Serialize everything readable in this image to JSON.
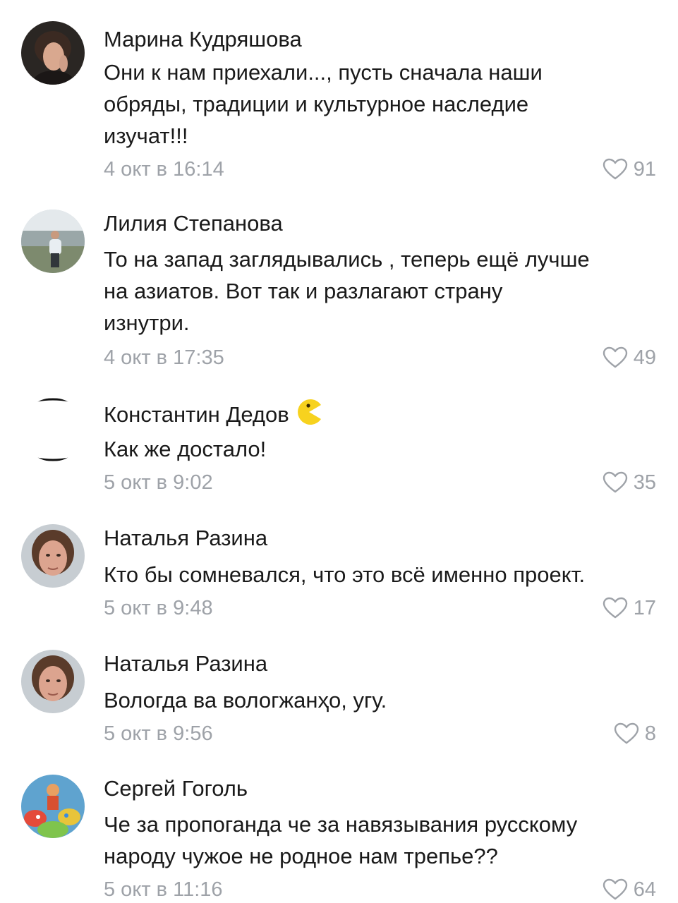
{
  "comments": [
    {
      "author": "Марина Кудряшова",
      "text_lines": [
        "Они к нам приехали..., пусть сначала наши",
        "обряды, традиции и культурное наследие",
        "изучат!!!"
      ],
      "date": "4 окт в 16:14",
      "likes": "91"
    },
    {
      "author": "Лилия Степанова",
      "text_lines": [
        "То на запад заглядывались , теперь ещё лучше",
        "на азиатов. Вот так и разлагают страну",
        "изнутри."
      ],
      "date": "4 окт в 17:35",
      "likes": "49"
    },
    {
      "author": "Константин Дедов",
      "text_lines": [
        "Как же достало!"
      ],
      "date": "5 окт в 9:02",
      "likes": "35",
      "badge_icon": "pacman-emoji-icon"
    },
    {
      "author": "Наталья Разина",
      "text_lines": [
        "Кто бы сомневался, что это всё именно проект."
      ],
      "date": "5 окт в 9:48",
      "likes": "17"
    },
    {
      "author": "Наталья Разина",
      "text_lines": [
        "Вологда ва вологжанҳо, угу."
      ],
      "date": "5 окт в 9:56",
      "likes": "8"
    },
    {
      "author": "Сергей Гоголь",
      "text_lines": [
        "Че за пропоганда че за навязывания русскому",
        "народу чужое не родное нам трепье??"
      ],
      "date": "5 окт в 11:16",
      "likes": "64"
    }
  ],
  "colors": {
    "text": "#1a1a1a",
    "meta": "#9ea2a8",
    "background": "#ffffff"
  },
  "icons": {
    "like": "heart-outline-icon"
  }
}
